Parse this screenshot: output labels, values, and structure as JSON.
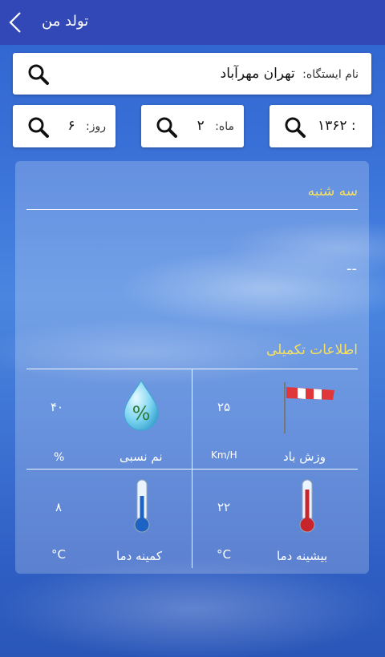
{
  "header": {
    "title": "تولد من",
    "back_icon": "chevron-left-icon"
  },
  "station": {
    "label": "نام ایستگاه:",
    "value": "تهران مهرآباد",
    "icon": "search-icon"
  },
  "date": {
    "day_label": "روز:",
    "day_value": "۶",
    "month_label": "ماه:",
    "month_value": "۲",
    "year_value": "۱۳۶۲ :"
  },
  "weather": {
    "weekday": "سه شنبه",
    "summary": "--",
    "extra_title": "اطلاعات تکمیلی",
    "wind_label": "وزش باد",
    "wind_value": "۲۵",
    "wind_unit": "Km/H",
    "humidity_label": "نم نسبی",
    "humidity_value": "۴۰",
    "humidity_unit": "%",
    "humidity_icon_text": "%",
    "max_temp_label": "بیشینه دما",
    "max_temp_value": "۲۲",
    "max_temp_unit": "°C",
    "min_temp_label": "کمینه دما",
    "min_temp_value": "۸",
    "min_temp_unit": "°C"
  },
  "colors": {
    "header": "#3248b6",
    "accent_yellow": "#f7e060"
  }
}
